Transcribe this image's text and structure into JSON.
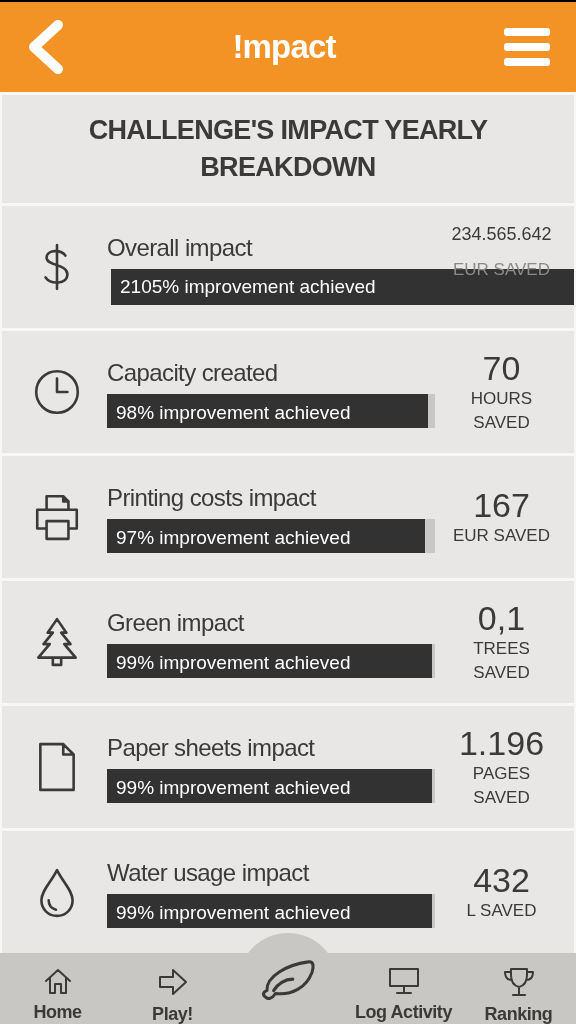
{
  "header": {
    "title": "!mpact"
  },
  "heading": "CHALLENGE'S IMPACT YEARLY BREAKDOWN",
  "rows": [
    {
      "kind": "overflow",
      "title": "Overall impact",
      "bar_text": "2105% improvement achieved",
      "value": "234.565.642",
      "unit": "EUR SAVED"
    },
    {
      "kind": "meter",
      "title": "Capacity created",
      "bar_text": "98% improvement achieved",
      "level": 0.98,
      "value": "70",
      "unit": "HOURS SAVED"
    },
    {
      "kind": "meter",
      "title": "Printing costs impact",
      "bar_text": "97% improvement achieved",
      "level": 0.97,
      "value": "167",
      "unit": "EUR SAVED"
    },
    {
      "kind": "meter",
      "title": "Green impact",
      "bar_text": "99% improvement achieved",
      "level": 0.99,
      "value": "0,1",
      "unit": "TREES SAVED"
    },
    {
      "kind": "meter",
      "title": "Paper sheets impact",
      "bar_text": "99% improvement achieved",
      "level": 0.99,
      "value": "1.196",
      "unit": "PAGES SAVED"
    },
    {
      "kind": "meter",
      "title": "Water usage impact",
      "bar_text": "99% improvement achieved",
      "level": 0.99,
      "value": "432",
      "unit": "L SAVED"
    }
  ],
  "nav": [
    {
      "label": "Home"
    },
    {
      "label": "Play!"
    },
    {
      "kind": "center"
    },
    {
      "label": "Log Activity"
    },
    {
      "label": "Ranking"
    }
  ]
}
